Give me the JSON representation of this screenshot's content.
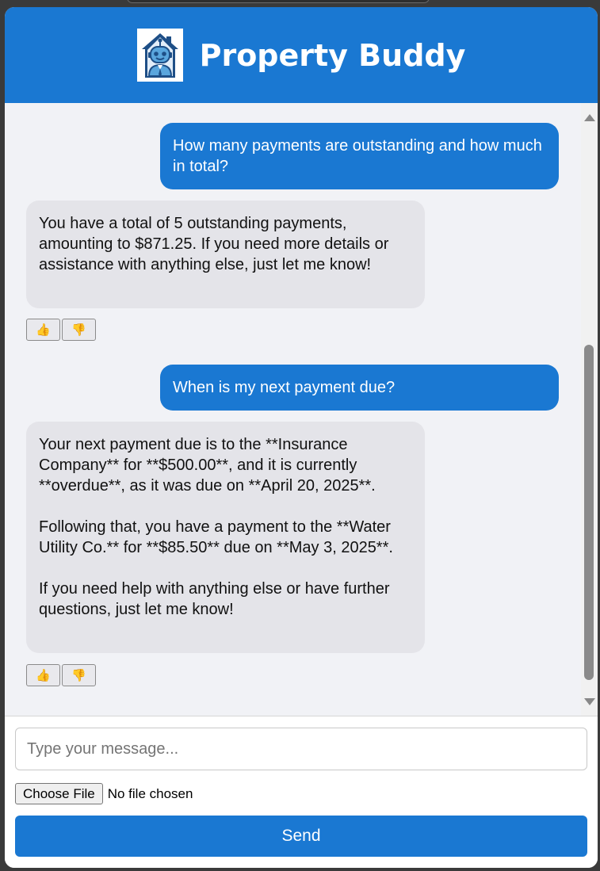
{
  "app": {
    "title": "Property Buddy",
    "logo_icon": "robot-house-icon",
    "brand_color": "#1a78d2"
  },
  "messages": [
    {
      "role": "user",
      "text": "How many payments are outstanding and how much in total?"
    },
    {
      "role": "bot",
      "text": "You have a total of 5 outstanding payments, amounting to $871.25. If you need more details or assistance with anything else, just let me know!"
    },
    {
      "role": "user",
      "text": "When is my next payment due?"
    },
    {
      "role": "bot",
      "text": "Your next payment due is to the **Insurance Company** for **$500.00**, and it is currently **overdue**, as it was due on **April 20, 2025**.\n\nFollowing that, you have a payment to the **Water Utility Co.** for **$85.50** due on **May 3, 2025**.\n\nIf you need help with anything else or have further questions, just let me know!"
    }
  ],
  "feedback": {
    "thumbs_up": "👍",
    "thumbs_down": "👎"
  },
  "input": {
    "placeholder": "Type your message...",
    "value": ""
  },
  "file": {
    "button_label": "Choose File",
    "status": "No file chosen"
  },
  "send": {
    "label": "Send"
  }
}
